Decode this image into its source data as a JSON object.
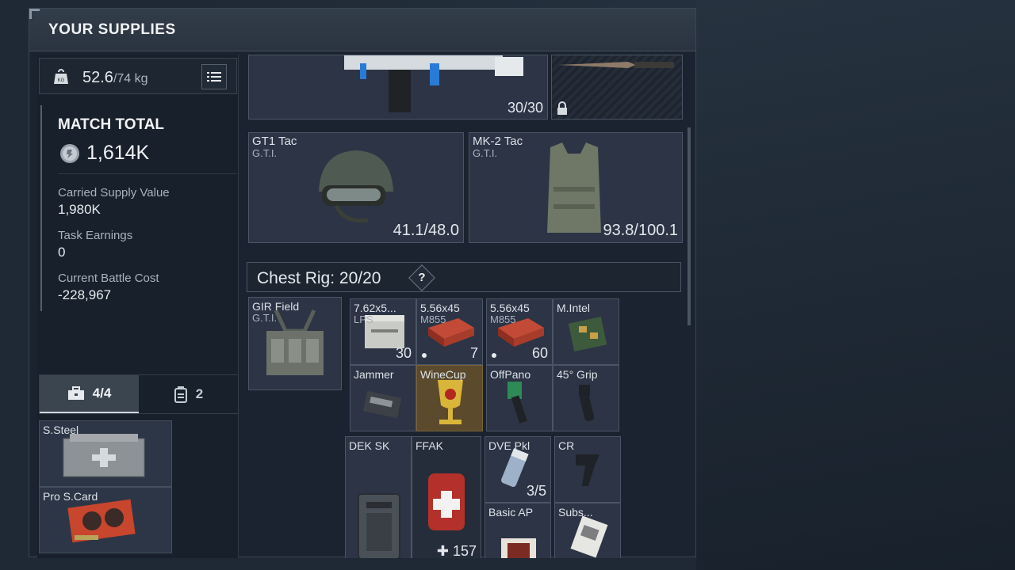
{
  "header": {
    "title": "YOUR SUPPLIES"
  },
  "weight": {
    "current": "52.6",
    "max": "/74 kg"
  },
  "match": {
    "title": "MATCH TOTAL",
    "total": "1,614K",
    "stats": [
      {
        "label": "Carried Supply Value",
        "value": "1,980K"
      },
      {
        "label": "Task Earnings",
        "value": "0"
      },
      {
        "label": "Current Battle Cost",
        "value": "-228,967"
      }
    ]
  },
  "tabs": [
    {
      "label": "4/4",
      "icon": "briefcase-icon"
    },
    {
      "label": "2",
      "icon": "backpack-icon"
    }
  ],
  "case_items": [
    {
      "label": "S.Steel"
    },
    {
      "label": "Pro S.Card"
    }
  ],
  "weapon": {
    "ammo": "30/30"
  },
  "helmet": {
    "name": "GT1 Tac",
    "brand": "G.T.I.",
    "durability": "41.1/48.0"
  },
  "armor": {
    "name": "MK-2 Tac",
    "brand": "G.T.I.",
    "durability": "93.8/100.1"
  },
  "chest_rig": {
    "label": "Chest Rig:",
    "capacity": "20/20",
    "help": "?"
  },
  "rig_item": {
    "name": "GIR Field",
    "brand": "G.T.I."
  },
  "rig_slots": [
    {
      "label": "7.62x5...",
      "sub": "LPS",
      "count": "30"
    },
    {
      "label": "5.56x45",
      "sub": "M855",
      "count": "7"
    },
    {
      "label": "5.56x45",
      "sub": "M855",
      "count": "60"
    },
    {
      "label": "M.Intel",
      "sub": "",
      "count": ""
    },
    {
      "label": "Jammer",
      "sub": "",
      "count": ""
    },
    {
      "label": "WineCup",
      "sub": "",
      "count": ""
    },
    {
      "label": "OffPano",
      "sub": "",
      "count": ""
    },
    {
      "label": "45° Grip",
      "sub": "",
      "count": ""
    }
  ],
  "bottom_items": [
    {
      "label": "DEK SK",
      "count": ""
    },
    {
      "label": "FFAK",
      "count": "157"
    },
    {
      "label": "DVE Pkl",
      "count": "3/5"
    },
    {
      "label": "CR",
      "count": ""
    },
    {
      "label": "Basic AP",
      "count": ""
    },
    {
      "label": "Subs...",
      "count": ""
    }
  ],
  "colors": {
    "accent": "#cfd6dd",
    "slot_bg": "#2c3446",
    "gold_slot": "#5b4a2c"
  }
}
